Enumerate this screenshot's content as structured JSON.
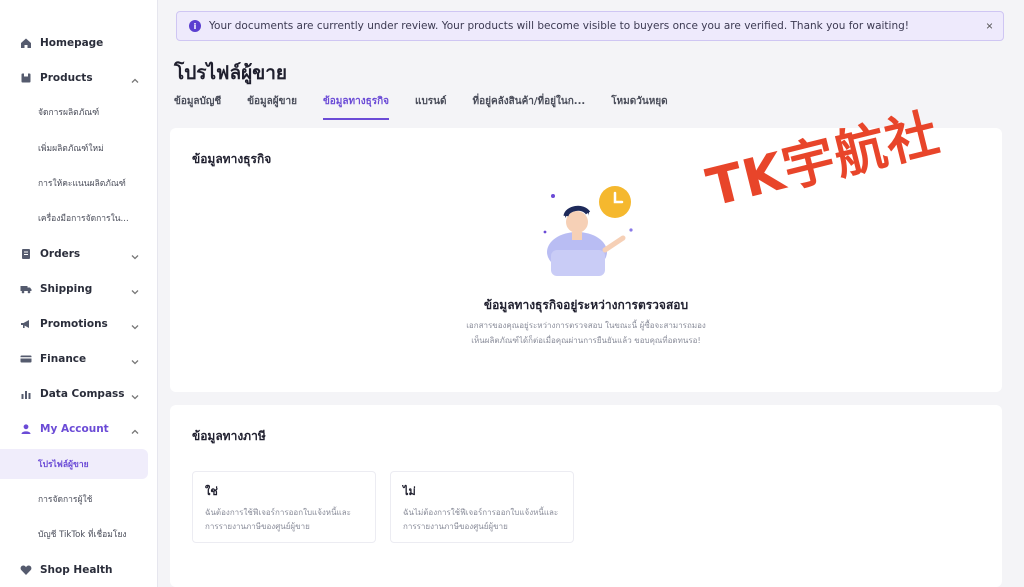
{
  "sidebar": {
    "items": [
      {
        "label": "Homepage",
        "icon": "home-icon"
      },
      {
        "label": "Products",
        "icon": "box-icon",
        "expanded": true
      },
      {
        "label": "Orders",
        "icon": "orders-icon"
      },
      {
        "label": "Shipping",
        "icon": "truck-icon"
      },
      {
        "label": "Promotions",
        "icon": "megaphone-icon"
      },
      {
        "label": "Finance",
        "icon": "card-icon"
      },
      {
        "label": "Data Compass",
        "icon": "chart-icon"
      },
      {
        "label": "My Account",
        "icon": "user-icon",
        "expanded": true,
        "active": true
      },
      {
        "label": "Shop Health",
        "icon": "health-icon"
      }
    ],
    "product_sub": [
      "จัดการผลิตภัณฑ์",
      "เพิ่มผลิตภัณฑ์ใหม่",
      "การให้คะแนนผลิตภัณฑ์",
      "เครื่องมือการจัดการใน..."
    ],
    "account_sub": [
      "โปรไฟล์ผู้ขาย",
      "การจัดการผู้ใช้",
      "บัญชี TikTok ที่เชื่อมโยง"
    ]
  },
  "banner": {
    "text": "Your documents are currently under review. Your products will become visible to buyers once you are verified. Thank you for waiting!",
    "info_glyph": "i",
    "close_glyph": "×"
  },
  "page": {
    "title": "โปรไฟล์ผู้ขาย",
    "tabs": [
      "ข้อมูลบัญชี",
      "ข้อมูลผู้ขาย",
      "ข้อมูลทางธุรกิจ",
      "แบรนด์",
      "ที่อยู่คลังสินค้า/ที่อยู่ในก...",
      "โหมดวันหยุด"
    ],
    "active_tab": 2
  },
  "business": {
    "title": "ข้อมูลทางธุรกิจ",
    "review_title": "ข้อมูลทางธุรกิจอยู่ระหว่างการตรวจสอบ",
    "review_desc": "เอกสารของคุณอยู่ระหว่างการตรวจสอบ ในขณะนี้ ผู้ซื้อจะสามารถมองเห็นผลิตภัณฑ์ได้ก็ต่อเมื่อคุณผ่านการยืนยันแล้ว ขอบคุณที่อดทนรอ!"
  },
  "tax": {
    "title": "ข้อมูลทางภาษี",
    "options": [
      {
        "title": "ใช่",
        "desc": "ฉันต้องการใช้ฟีเจอร์การออกใบแจ้งหนี้และการรายงานภาษีของศูนย์ผู้ขาย"
      },
      {
        "title": "ไม่",
        "desc": "ฉันไม่ต้องการใช้ฟีเจอร์การออกใบแจ้งหนี้และการรายงานภาษีของศูนย์ผู้ขาย"
      }
    ]
  },
  "watermark": "TK宇航社",
  "colors": {
    "accent": "#6b4bd6",
    "banner_bg": "#eeeafc",
    "watermark": "#e8452a",
    "clock": "#f5b82e"
  }
}
